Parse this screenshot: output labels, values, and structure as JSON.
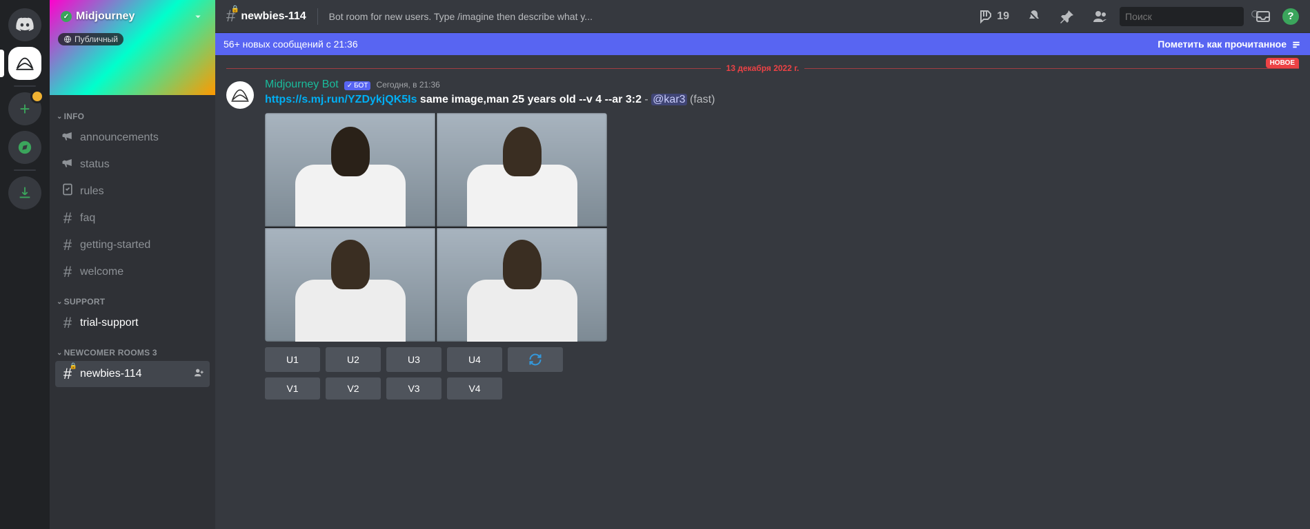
{
  "server": {
    "name": "Midjourney",
    "public_tag": "Публичный"
  },
  "categories": [
    {
      "name": "INFO",
      "channels": [
        {
          "key": "announcements",
          "label": "announcements",
          "icon": "megaphone"
        },
        {
          "key": "status",
          "label": "status",
          "icon": "megaphone"
        },
        {
          "key": "rules",
          "label": "rules",
          "icon": "rules"
        },
        {
          "key": "faq",
          "label": "faq",
          "icon": "hash"
        },
        {
          "key": "getting-started",
          "label": "getting-started",
          "icon": "hash"
        },
        {
          "key": "welcome",
          "label": "welcome",
          "icon": "hash"
        }
      ]
    },
    {
      "name": "SUPPORT",
      "channels": [
        {
          "key": "trial-support",
          "label": "trial-support",
          "icon": "hash",
          "unread": true
        }
      ]
    },
    {
      "name": "NEWCOMER ROOMS 3",
      "channels": [
        {
          "key": "newbies-114",
          "label": "newbies-114",
          "icon": "hashlock",
          "selected": true,
          "invite": true
        }
      ]
    }
  ],
  "topbar": {
    "channel_name": "newbies-114",
    "topic": "Bot room for new users. Type /imagine then describe what y...",
    "threads_count": "19",
    "search_placeholder": "Поиск"
  },
  "new_messages_bar": {
    "text": "56+ новых сообщений с 21:36",
    "mark_read": "Пометить как прочитанное"
  },
  "date_divider": {
    "label": "13 декабря 2022 г.",
    "new_pill": "НОВОЕ"
  },
  "message": {
    "author": "Midjourney Bot",
    "bot_tag": "БОТ",
    "timestamp": "Сегодня, в 21:36",
    "link_text": "https://s.mj.run/YZDykjQK5Is",
    "prompt_text": " same image,man 25 years old --v 4 --ar 3:2",
    "dash": " - ",
    "mention": "@kar3",
    "meta": " (fast)"
  },
  "buttons": {
    "u": [
      "U1",
      "U2",
      "U3",
      "U4"
    ],
    "v": [
      "V1",
      "V2",
      "V3",
      "V4"
    ]
  }
}
